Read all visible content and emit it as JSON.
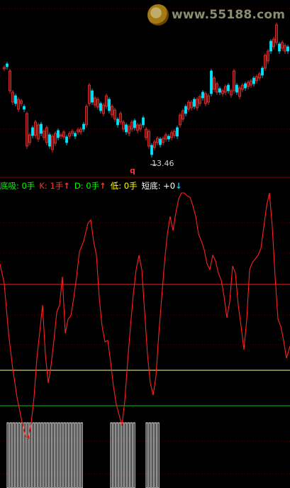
{
  "watermark": {
    "text": "www.55188.com",
    "logo_icon": "gold-coin-logo-icon"
  },
  "price_chart": {
    "low_label": "13.46",
    "marker_label": "q",
    "colors": {
      "up": "#ff3232",
      "down": "#00e4ff",
      "grid": "#7a0000"
    }
  },
  "indicator_legend": {
    "items": [
      {
        "label": "底吸",
        "value": "0手",
        "color": "#00ff00",
        "arrow": ""
      },
      {
        "label": "K",
        "value": "1手",
        "color": "#ff3232",
        "arrow": "↑"
      },
      {
        "label": "D",
        "value": "0手",
        "color": "#00ff00",
        "arrow": "↑"
      },
      {
        "label": "低",
        "value": "0手",
        "color": "#ffff00",
        "arrow": ""
      },
      {
        "label": "短底",
        "value": "+0",
        "color": "#ffffff",
        "arrow": "↓"
      }
    ]
  },
  "indicator_chart": {
    "colors": {
      "line": "#ff2020",
      "upper_ref": "#ff2020",
      "mid_ref": "#ffff80",
      "low_ref": "#00c800",
      "bars": "#ffffff"
    }
  }
}
